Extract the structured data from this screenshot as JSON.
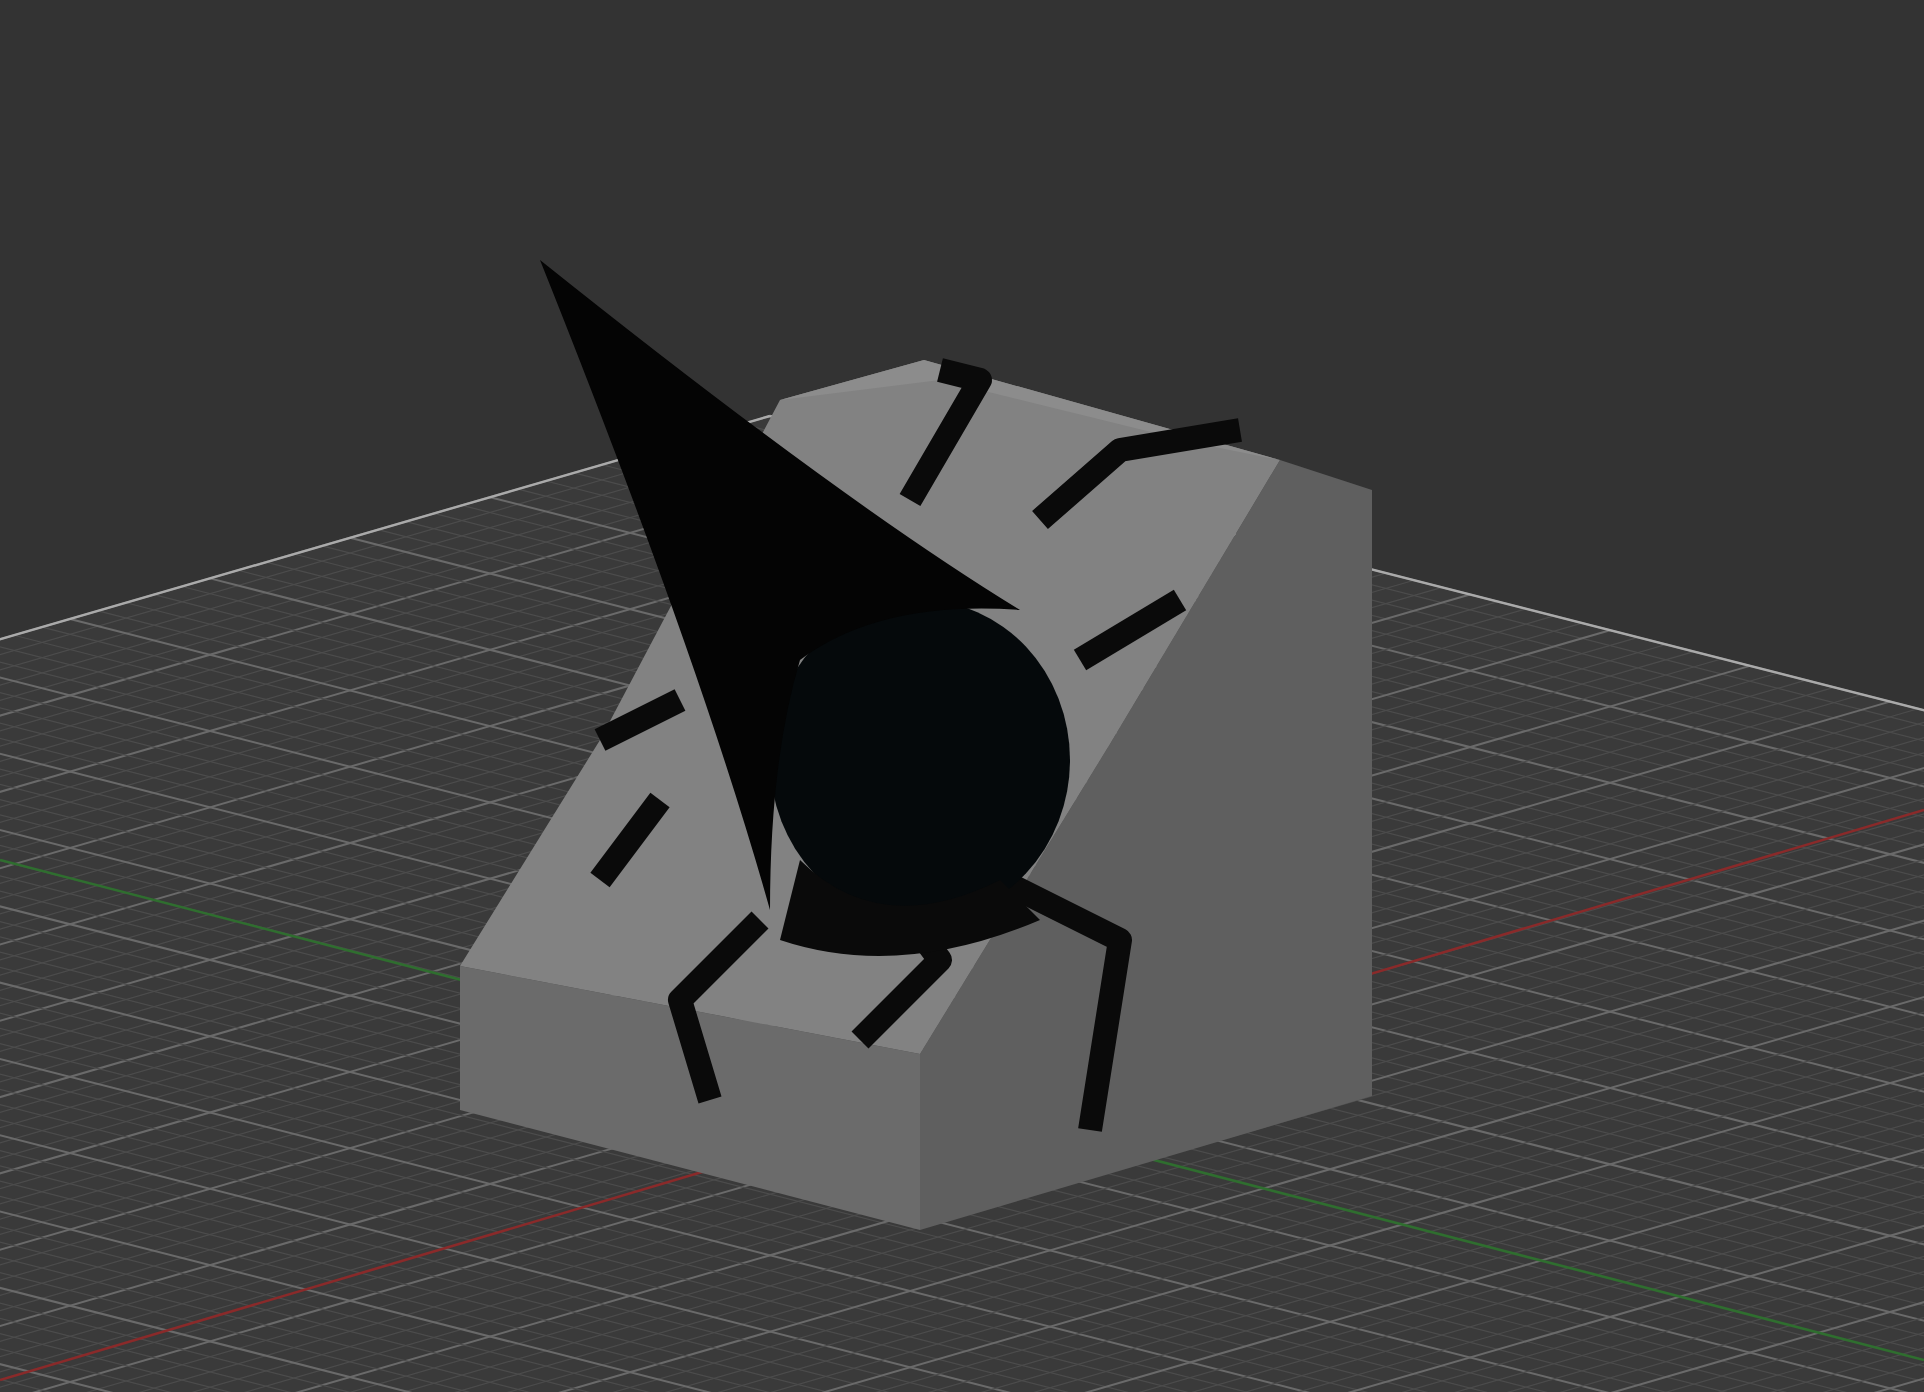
{
  "viewport": {
    "axes": [
      {
        "kind": "x",
        "color": "#8a2a2a"
      },
      {
        "kind": "y",
        "color": "#2f6e2f"
      }
    ]
  }
}
